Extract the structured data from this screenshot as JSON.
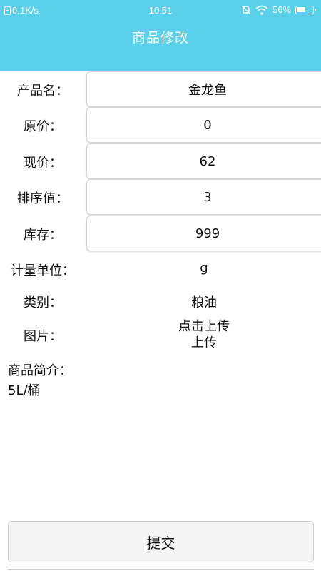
{
  "status_bar": {
    "speed": "0.1K/s",
    "time": "10:51",
    "battery_percent": "56%",
    "battery_level": 0.56
  },
  "header": {
    "title": "商品修改"
  },
  "form": {
    "product_name": {
      "label": "产品名：",
      "value": "金龙鱼"
    },
    "original_price": {
      "label": "原价：",
      "value": "0"
    },
    "current_price": {
      "label": "现价：",
      "value": "62"
    },
    "sort_value": {
      "label": "排序值：",
      "value": "3"
    },
    "stock": {
      "label": "库存：",
      "value": "999"
    },
    "unit": {
      "label": "计量单位：",
      "value": "g"
    },
    "category": {
      "label": "类别：",
      "value": "粮油"
    },
    "image": {
      "label": "图片：",
      "upload_hint": "点击上传",
      "upload_label": "上传"
    },
    "description": {
      "label": "商品简介：",
      "value": "5L/桶"
    }
  },
  "submit_label": "提交",
  "colors": {
    "header_bg": "#5ad0ea",
    "text": "#111111"
  }
}
